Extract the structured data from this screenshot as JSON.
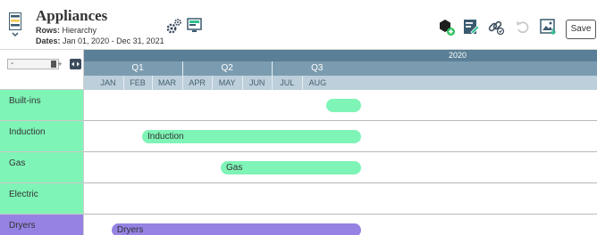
{
  "header": {
    "title": "Appliances",
    "rows_label": "Rows:",
    "rows_value": "Hierarchy",
    "dates_label": "Dates:",
    "dates_value": "Jan 01, 2020 - Dec 31, 2021",
    "save_label": "Save",
    "icons": [
      "app-menu-icon",
      "settings-gears-icon",
      "view-layout-icon",
      "add-item-icon",
      "edit-pencil-icon",
      "link-chain-icon",
      "undo-icon",
      "export-image-icon"
    ]
  },
  "toolbar": {
    "zoom_minus": "-",
    "zoom_plus": "+"
  },
  "timeline": {
    "year": "2020",
    "quarters": [
      "Q1",
      "Q2",
      "Q3"
    ],
    "months": [
      "JAN",
      "FEB",
      "MAR",
      "APR",
      "MAY",
      "JUN",
      "JUL",
      "AUG"
    ]
  },
  "rows": [
    {
      "label": "Built-ins",
      "color": "#7ef4b6",
      "bar_label": "",
      "bar_start": "2020-08-25",
      "bar_end": "2020-09-30"
    },
    {
      "label": "Induction",
      "color": "#7ef4b6",
      "bar_label": "Induction",
      "bar_start": "2020-02-20",
      "bar_end": "2020-09-30"
    },
    {
      "label": "Gas",
      "color": "#7ef4b6",
      "bar_label": "Gas",
      "bar_start": "2020-05-10",
      "bar_end": "2020-09-30"
    },
    {
      "label": "Electric",
      "color": "#7ef4b6",
      "bar_label": "",
      "bar_start": "",
      "bar_end": ""
    },
    {
      "label": "Dryers",
      "color": "#9582e2",
      "bar_label": "Dryers",
      "bar_start": "2020-01-20",
      "bar_end": "2020-09-30"
    }
  ],
  "colors": {
    "accent_green": "#7ef4b6",
    "accent_purple": "#9582e2",
    "year_band": "#5a7f96",
    "quarter_band": "#7b9cb0",
    "month_band": "#bccfdb"
  }
}
